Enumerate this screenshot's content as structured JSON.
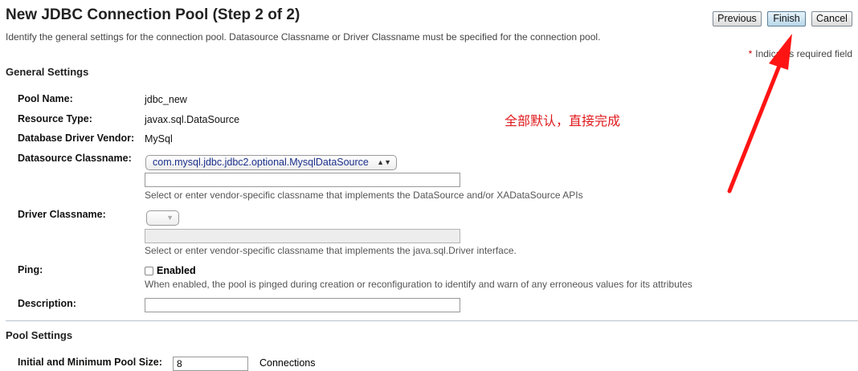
{
  "header": {
    "title": "New JDBC Connection Pool (Step 2 of 2)",
    "description": "Identify the general settings for the connection pool. Datasource Classname or Driver Classname must be specified for the connection pool.",
    "buttons": {
      "previous": "Previous",
      "finish": "Finish",
      "cancel": "Cancel"
    },
    "required_note": {
      "star": "*",
      "text": "Indicates required field"
    }
  },
  "annotation": {
    "text": "全部默认，直接完成",
    "color": "#e0191c"
  },
  "general": {
    "heading": "General Settings",
    "pool_name": {
      "label": "Pool Name:",
      "value": "jdbc_new"
    },
    "resource_type": {
      "label": "Resource Type:",
      "value": "javax.sql.DataSource"
    },
    "vendor": {
      "label": "Database Driver Vendor:",
      "value": "MySql"
    },
    "ds_class": {
      "label": "Datasource Classname:",
      "selected": "com.mysql.jdbc.jdbc2.optional.MysqlDataSource",
      "input_value": "",
      "help": "Select or enter vendor-specific classname that implements the DataSource and/or XADataSource APIs"
    },
    "driver_class": {
      "label": "Driver Classname:",
      "selected": "",
      "input_value": "",
      "help": "Select or enter vendor-specific classname that implements the java.sql.Driver interface."
    },
    "ping": {
      "label": "Ping:",
      "checkbox_label": "Enabled",
      "checked": false,
      "help": "When enabled, the pool is pinged during creation or reconfiguration to identify and warn of any erroneous values for its attributes"
    },
    "description": {
      "label": "Description:",
      "value": ""
    }
  },
  "pool": {
    "heading": "Pool Settings",
    "initial_min": {
      "label": "Initial and Minimum Pool Size:",
      "value": "8",
      "unit": "Connections"
    }
  },
  "icons": {
    "select_arrows": "up-down-arrows-icon",
    "annotation_arrow": "red-arrow-icon"
  }
}
